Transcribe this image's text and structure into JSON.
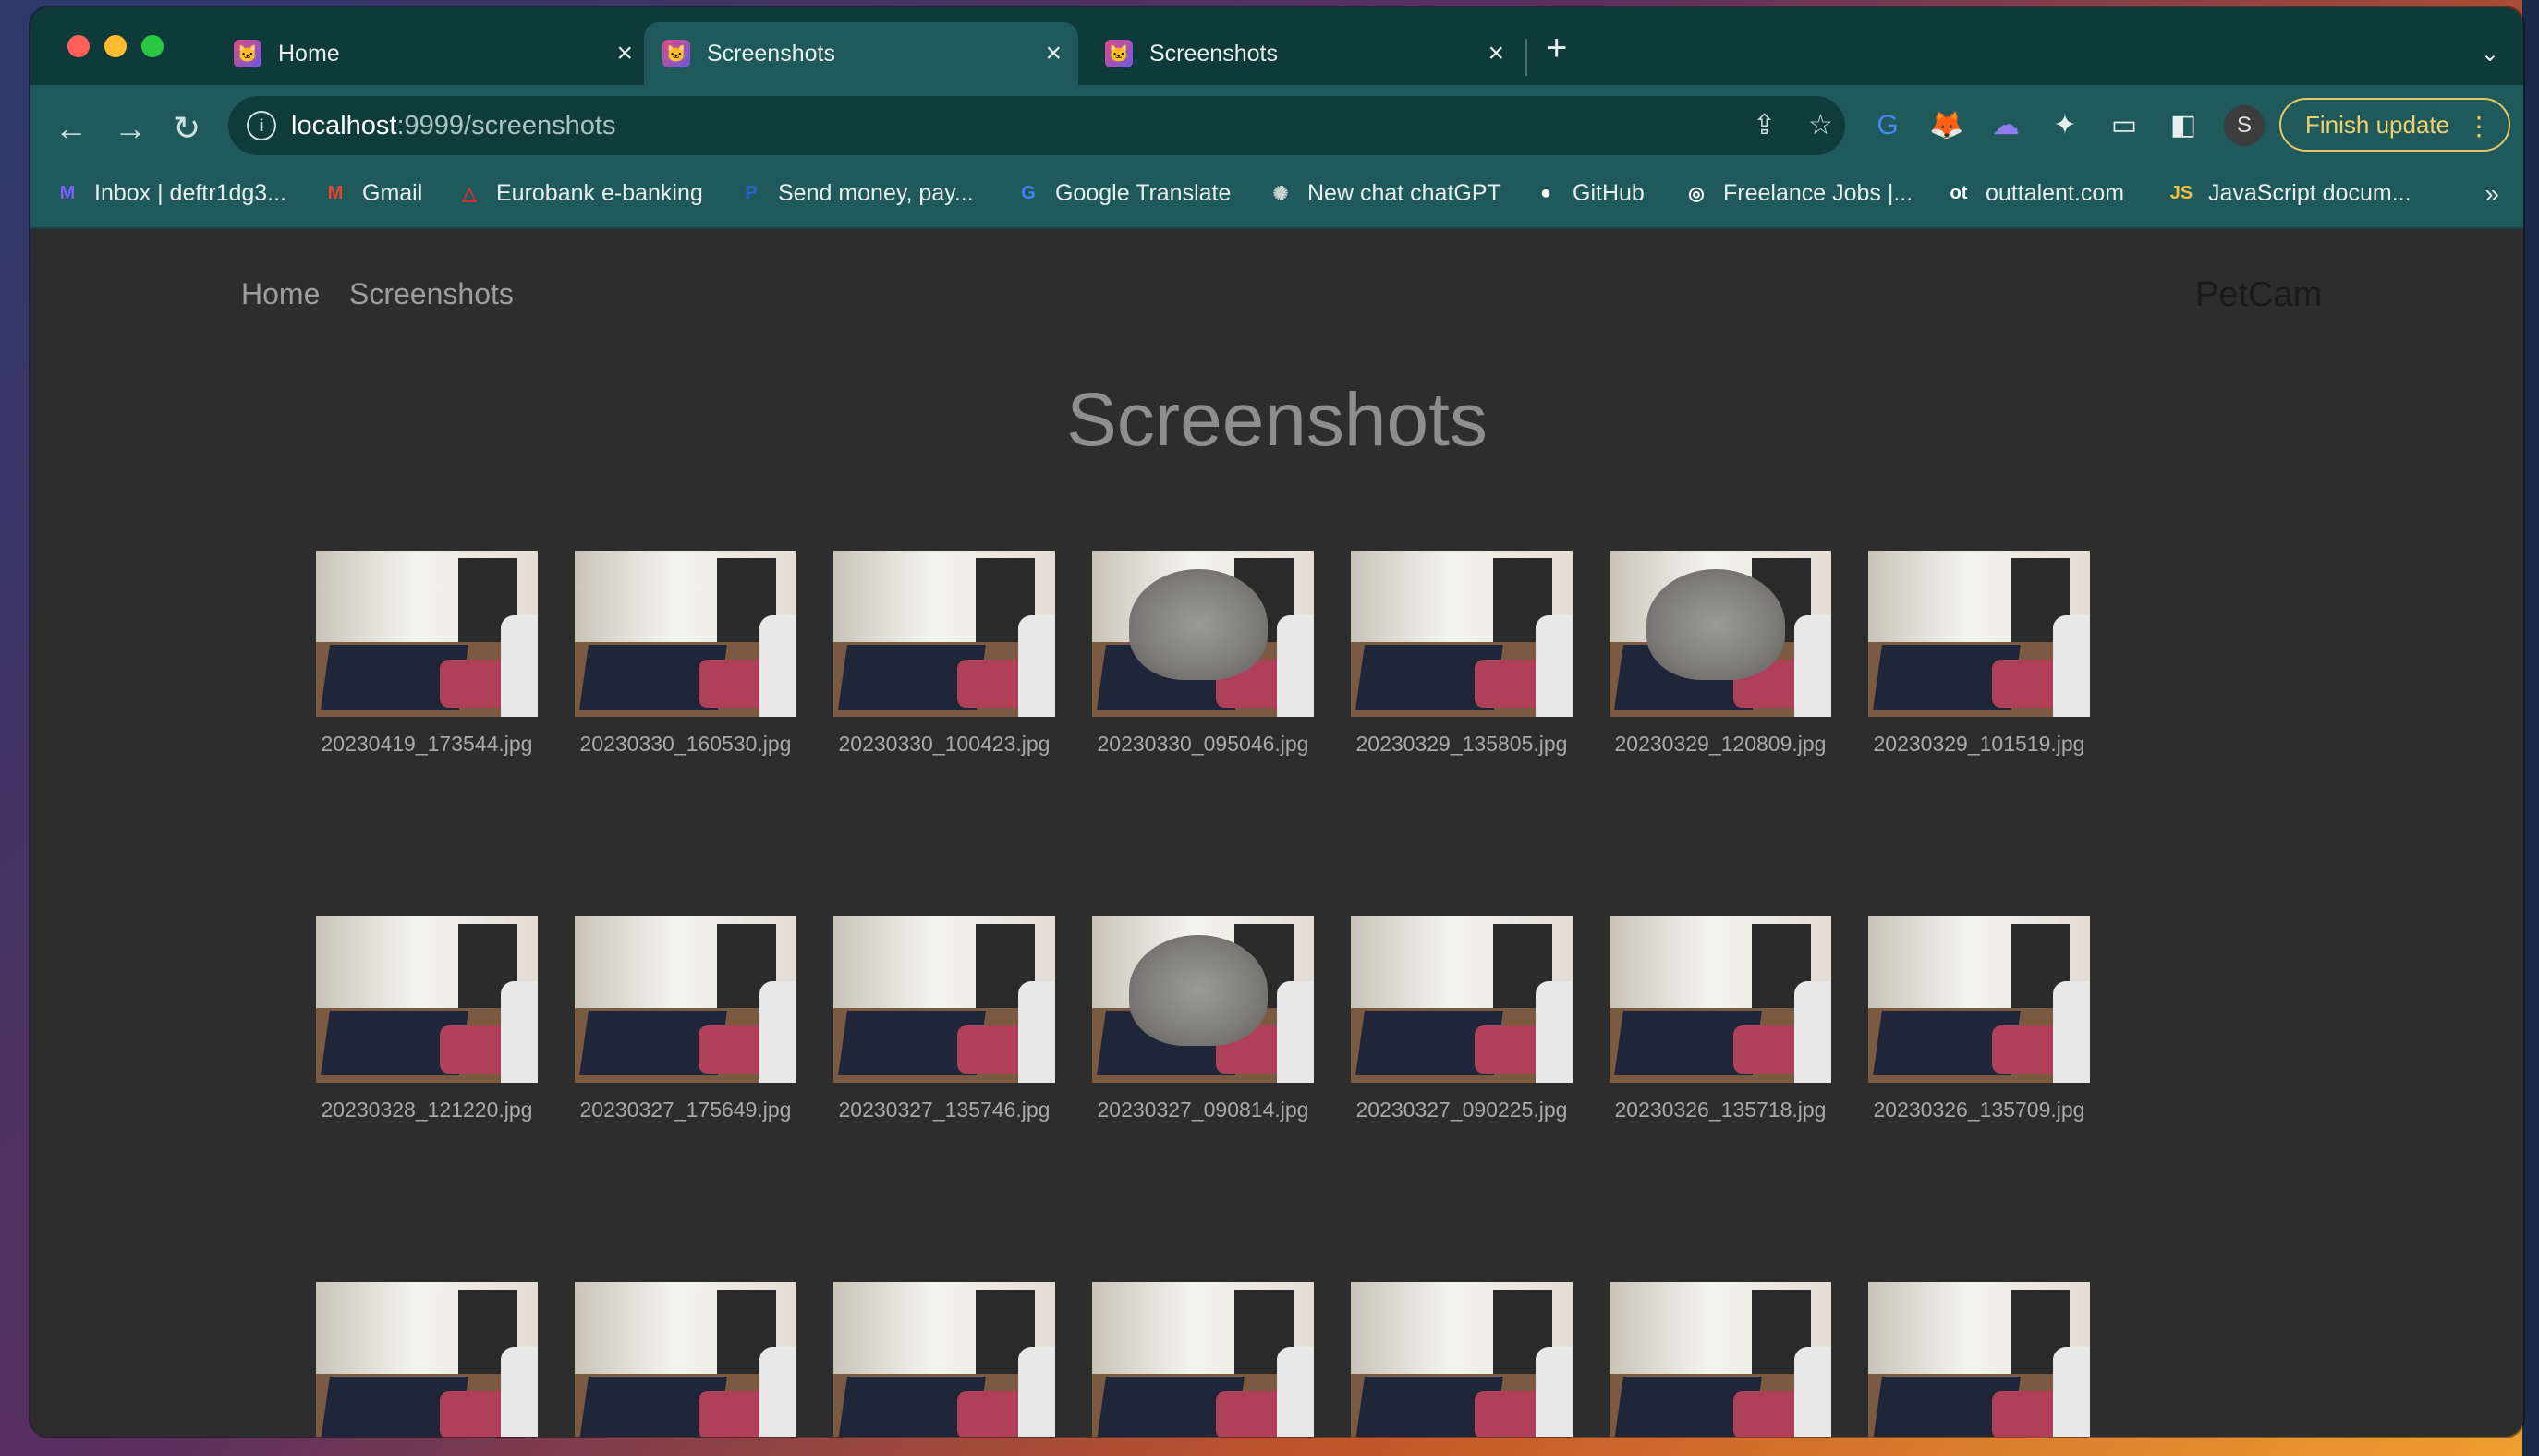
{
  "browser": {
    "tabs": [
      {
        "title": "Home",
        "active": false
      },
      {
        "title": "Screenshots",
        "active": true
      },
      {
        "title": "Screenshots",
        "active": false
      }
    ],
    "url_host": "localhost",
    "url_rest": ":9999/screenshots",
    "profile_initial": "S",
    "update_label": "Finish update",
    "bookmarks": [
      {
        "label": "Inbox | deftr1dg3...",
        "icon": "proton-mail-icon",
        "glyph": "M",
        "color": "#7b5cff"
      },
      {
        "label": "Gmail",
        "icon": "gmail-icon",
        "glyph": "M",
        "color": "#ea4335"
      },
      {
        "label": "Eurobank e-banking",
        "icon": "eurobank-icon",
        "glyph": "△",
        "color": "#d32f2f"
      },
      {
        "label": "Send money, pay...",
        "icon": "paypal-icon",
        "glyph": "P",
        "color": "#2a62c9"
      },
      {
        "label": "Google Translate",
        "icon": "google-translate-icon",
        "glyph": "G",
        "color": "#4285f4"
      },
      {
        "label": "New chat chatGPT",
        "icon": "chatgpt-icon",
        "glyph": "✺",
        "color": "#c8d0d0"
      },
      {
        "label": "GitHub",
        "icon": "github-icon",
        "glyph": "●",
        "color": "#ffffff"
      },
      {
        "label": "Freelance Jobs |...",
        "icon": "upwork-icon",
        "glyph": "◎",
        "color": "#ffffff"
      },
      {
        "label": "outtalent.com",
        "icon": "outtalent-icon",
        "glyph": "ot",
        "color": "#ffffff"
      },
      {
        "label": "JavaScript docum...",
        "icon": "javascript-docs-icon",
        "glyph": "JS",
        "color": "#f0c040"
      }
    ],
    "bookmarks_more": "»"
  },
  "site": {
    "nav": [
      {
        "label": "Home"
      },
      {
        "label": "Screenshots"
      }
    ],
    "brand": "PetCam",
    "page_title": "Screenshots"
  },
  "gallery": [
    {
      "file": "20230419_173544.jpg",
      "cat": false
    },
    {
      "file": "20230330_160530.jpg",
      "cat": false
    },
    {
      "file": "20230330_100423.jpg",
      "cat": false
    },
    {
      "file": "20230330_095046.jpg",
      "cat": true
    },
    {
      "file": "20230329_135805.jpg",
      "cat": false
    },
    {
      "file": "20230329_120809.jpg",
      "cat": true
    },
    {
      "file": "20230329_101519.jpg",
      "cat": false
    },
    {
      "file": "20230328_121220.jpg",
      "cat": false
    },
    {
      "file": "20230327_175649.jpg",
      "cat": false
    },
    {
      "file": "20230327_135746.jpg",
      "cat": false
    },
    {
      "file": "20230327_090814.jpg",
      "cat": true
    },
    {
      "file": "20230327_090225.jpg",
      "cat": false
    },
    {
      "file": "20230326_135718.jpg",
      "cat": false
    },
    {
      "file": "20230326_135709.jpg",
      "cat": false
    },
    {
      "file": "",
      "cat": false
    },
    {
      "file": "",
      "cat": false
    },
    {
      "file": "",
      "cat": false
    },
    {
      "file": "",
      "cat": false
    },
    {
      "file": "",
      "cat": false
    },
    {
      "file": "",
      "cat": false
    },
    {
      "file": "",
      "cat": false
    }
  ]
}
